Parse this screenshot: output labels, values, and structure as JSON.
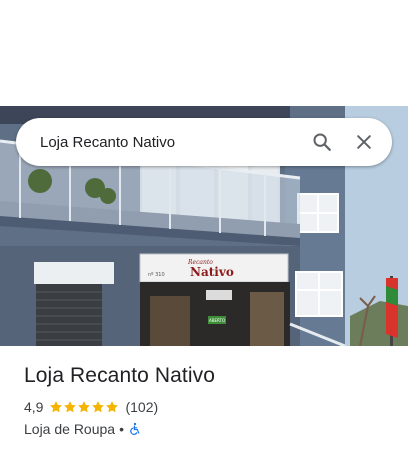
{
  "search": {
    "query": "Loja Recanto Nativo"
  },
  "photo": {
    "sign_script": "Recanto",
    "sign_main": "Nativo",
    "sign_number": "nº 310",
    "door_sign": "ABERTO"
  },
  "place": {
    "name": "Loja Recanto Nativo",
    "rating": "4,9",
    "stars": 5,
    "review_count": "(102)",
    "category": "Loja de Roupa",
    "separator": "•",
    "accessibility_icon": "wheelchair-icon"
  },
  "colors": {
    "star": "#f4b400",
    "accessibility": "#1a73e8",
    "text_primary": "#202124",
    "text_secondary": "#3c4043"
  }
}
